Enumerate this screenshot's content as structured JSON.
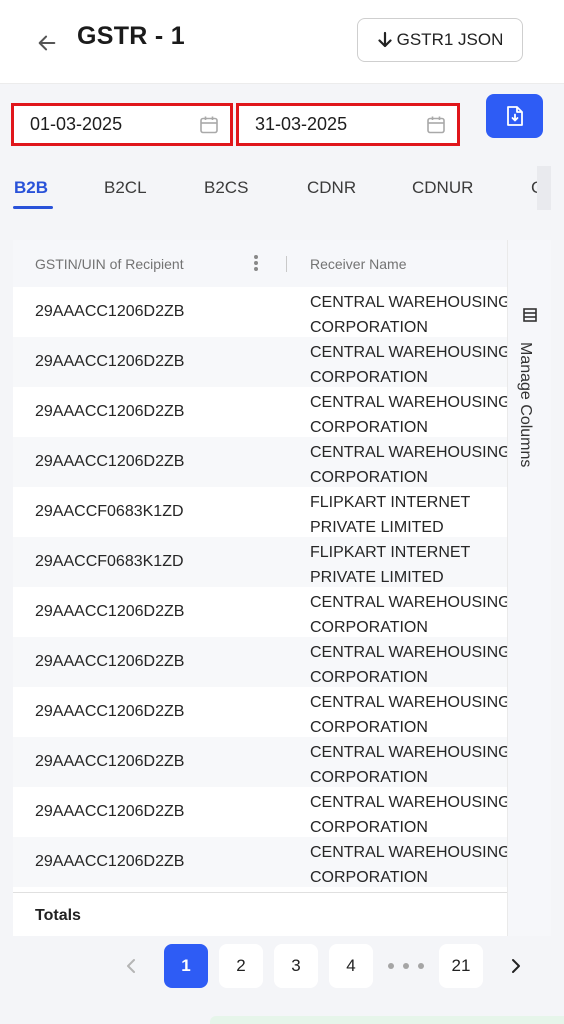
{
  "header": {
    "title": "GSTR - 1",
    "json_button_label": "GSTR1 JSON",
    "json_button_icon": "arrow-down-icon",
    "back_icon": "arrow-left-icon"
  },
  "filters": {
    "from_date": "01-03-2025",
    "to_date": "31-03-2025",
    "calendar_icon": "calendar-icon",
    "download_button_icon": "file-download-icon"
  },
  "tabs": [
    {
      "label": "B2B",
      "active": true
    },
    {
      "label": "B2CL",
      "active": false
    },
    {
      "label": "B2CS",
      "active": false
    },
    {
      "label": "CDNR",
      "active": false
    },
    {
      "label": "CDNUR",
      "active": false
    },
    {
      "label": "CC",
      "active": false
    }
  ],
  "table": {
    "columns": [
      "GSTIN/UIN of Recipient",
      "Receiver Name"
    ],
    "rows": [
      {
        "gstin": "29AAACC1206D2ZB",
        "name_line1": "CENTRAL WAREHOUSING",
        "name_line2": "CORPORATION"
      },
      {
        "gstin": "29AAACC1206D2ZB",
        "name_line1": "CENTRAL WAREHOUSING",
        "name_line2": "CORPORATION"
      },
      {
        "gstin": "29AAACC1206D2ZB",
        "name_line1": "CENTRAL WAREHOUSING",
        "name_line2": "CORPORATION"
      },
      {
        "gstin": "29AAACC1206D2ZB",
        "name_line1": "CENTRAL WAREHOUSING",
        "name_line2": "CORPORATION"
      },
      {
        "gstin": "29AACCF0683K1ZD",
        "name_line1": "FLIPKART INTERNET",
        "name_line2": "PRIVATE LIMITED"
      },
      {
        "gstin": "29AACCF0683K1ZD",
        "name_line1": "FLIPKART INTERNET",
        "name_line2": "PRIVATE LIMITED"
      },
      {
        "gstin": "29AAACC1206D2ZB",
        "name_line1": "CENTRAL WAREHOUSING",
        "name_line2": "CORPORATION"
      },
      {
        "gstin": "29AAACC1206D2ZB",
        "name_line1": "CENTRAL WAREHOUSING",
        "name_line2": "CORPORATION"
      },
      {
        "gstin": "29AAACC1206D2ZB",
        "name_line1": "CENTRAL WAREHOUSING",
        "name_line2": "CORPORATION"
      },
      {
        "gstin": "29AAACC1206D2ZB",
        "name_line1": "CENTRAL WAREHOUSING",
        "name_line2": "CORPORATION"
      },
      {
        "gstin": "29AAACC1206D2ZB",
        "name_line1": "CENTRAL WAREHOUSING",
        "name_line2": "CORPORATION"
      },
      {
        "gstin": "29AAACC1206D2ZB",
        "name_line1": "CENTRAL WAREHOUSING",
        "name_line2": "CORPORATION"
      }
    ],
    "totals_label": "Totals",
    "manage_columns_label": "Manage Columns",
    "manage_columns_icon": "columns-icon",
    "column_menu_icon": "kebab-menu-icon"
  },
  "pagination": {
    "pages": [
      "1",
      "2",
      "3",
      "4"
    ],
    "last_page": "21",
    "current": "1",
    "prev_icon": "chevron-left-icon",
    "next_icon": "chevron-right-icon"
  },
  "colors": {
    "primary": "#2e5cf5",
    "active_tab": "#2952d9",
    "highlight_border": "#e0161b"
  }
}
